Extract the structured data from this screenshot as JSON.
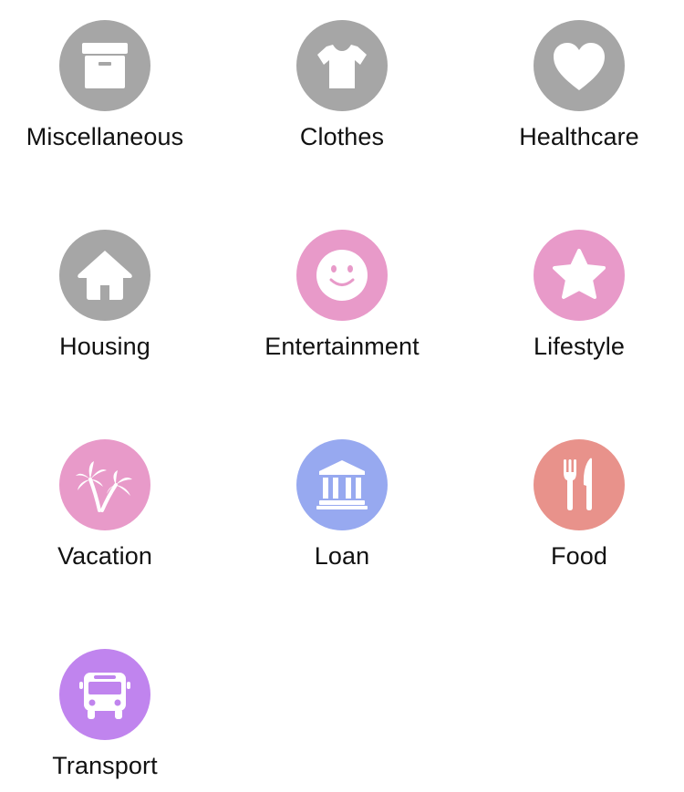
{
  "categories": [
    {
      "label": "Miscellaneous",
      "icon": "archive-box-icon",
      "color": "#a6a6a6"
    },
    {
      "label": "Clothes",
      "icon": "t-shirt-icon",
      "color": "#a6a6a6"
    },
    {
      "label": "Healthcare",
      "icon": "heart-icon",
      "color": "#a6a6a6"
    },
    {
      "label": "Housing",
      "icon": "house-icon",
      "color": "#a6a6a6"
    },
    {
      "label": "Entertainment",
      "icon": "smiley-icon",
      "color": "#e89ac9"
    },
    {
      "label": "Lifestyle",
      "icon": "star-icon",
      "color": "#e89ac9"
    },
    {
      "label": "Vacation",
      "icon": "palm-trees-icon",
      "color": "#e89ac9"
    },
    {
      "label": "Loan",
      "icon": "bank-icon",
      "color": "#97a9f0"
    },
    {
      "label": "Food",
      "icon": "fork-knife-icon",
      "color": "#e8928b"
    },
    {
      "label": "Transport",
      "icon": "bus-icon",
      "color": "#c084ee"
    }
  ]
}
